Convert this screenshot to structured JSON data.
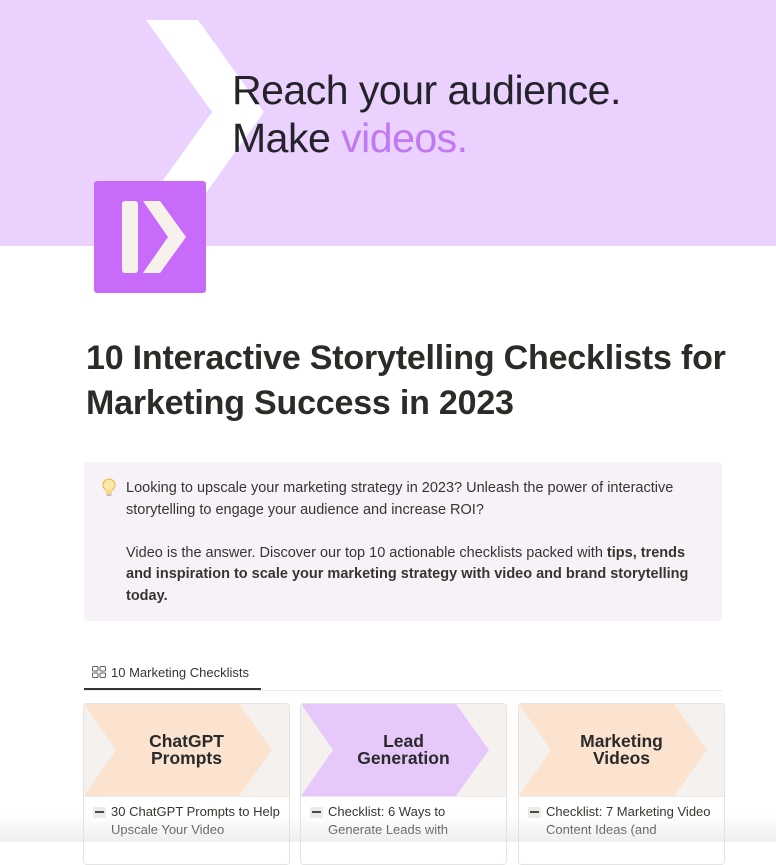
{
  "cover": {
    "headline_line1": "Reach your audience.",
    "headline_line2_plain": "Make ",
    "headline_line2_accent": "videos.",
    "background_color": "#ead1fe",
    "accent_color": "#c078f3",
    "chevron_icon": "chevron-right-icon"
  },
  "page": {
    "icon": "play-chevron-logo-icon",
    "icon_color": "#c86bfa",
    "title": "10 Interactive Storytelling Checklists for Marketing Success in 2023"
  },
  "callout": {
    "icon": "lightbulb-icon",
    "paragraph1": "Looking to upscale your marketing strategy in 2023? Unleash the power of interactive storytelling to engage your audience and increase ROI?",
    "paragraph2_plain": "Video is the answer. Discover our top 10 actionable checklists packed with ",
    "paragraph2_bold": "tips, trends and inspiration to scale your marketing strategy with video and brand storytelling today."
  },
  "database": {
    "tab_icon": "gallery-view-icon",
    "tab_label": "10 Marketing Checklists",
    "cards": [
      {
        "cover_label": "ChatGPT\nPrompts",
        "cover_color": "#fbe3d0",
        "favicon": "site-favicon-icon",
        "title": "30 ChatGPT Prompts to Help Upscale Your Video"
      },
      {
        "cover_label": "Lead\nGeneration",
        "cover_color": "#e6c8fb",
        "favicon": "site-favicon-icon",
        "title": "Checklist: 6 Ways to Generate Leads with"
      },
      {
        "cover_label": "Marketing\nVideos",
        "cover_color": "#fbe3d0",
        "favicon": "site-favicon-icon",
        "title": "Checklist: 7 Marketing Video Content Ideas (and"
      }
    ]
  }
}
